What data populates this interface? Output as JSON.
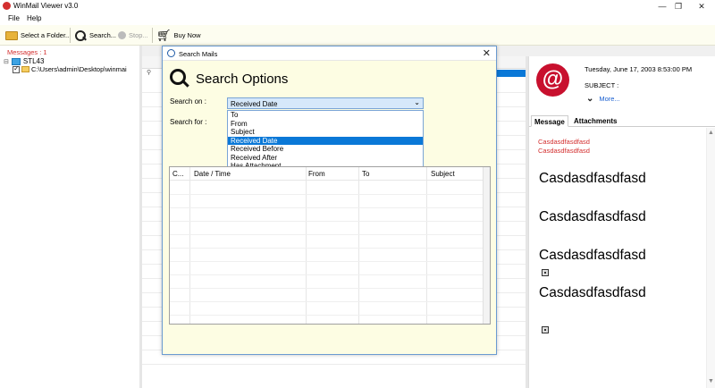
{
  "window": {
    "title": "WinMail Viewer v3.0",
    "minimize_glyph": "—",
    "restore_glyph": "❐",
    "close_glyph": "✕"
  },
  "menu": {
    "file": "File",
    "help": "Help"
  },
  "toolbar": {
    "select_folder": "Select a Folder...",
    "search": "Search...",
    "stop": "Stop...",
    "buy_now": "Buy Now"
  },
  "tree": {
    "messages_count": "Messages : 1",
    "root": "STL43",
    "child_path": "C:\\Users\\admin\\Desktop\\winmai"
  },
  "email": {
    "badge": "@",
    "date": "Tuesday, June 17, 2003 8:53:00 PM",
    "subject_label": "SUBJECT :",
    "more": "More...",
    "tabs": [
      "Message",
      "Attachments"
    ],
    "red_lines": [
      "Casdasdfasdfasd",
      "Casdasdfasdfasd"
    ],
    "big_lines": [
      "Casdasdfasdfasd",
      "Casdasdfasdfasd",
      "Casdasdfasdfasd",
      "Casdasdfasdfasd"
    ]
  },
  "dialog": {
    "title": "Search Mails",
    "heading": "Search Options",
    "search_on_label": "Search on :",
    "search_for_label": "Search for :",
    "selected_value": "Received Date",
    "options": [
      "To",
      "From",
      "Subject",
      "Received Date",
      "Received Before",
      "Received After",
      "Has Attachment"
    ],
    "selected_index": 3,
    "columns": [
      "C...",
      "Date / Time",
      "From",
      "To",
      "Subject"
    ]
  },
  "colors": {
    "accent_blue": "#0a78d7",
    "badge_red": "#c8102e",
    "message_red": "#d32f2f",
    "dialog_bg": "#fdfde3"
  }
}
